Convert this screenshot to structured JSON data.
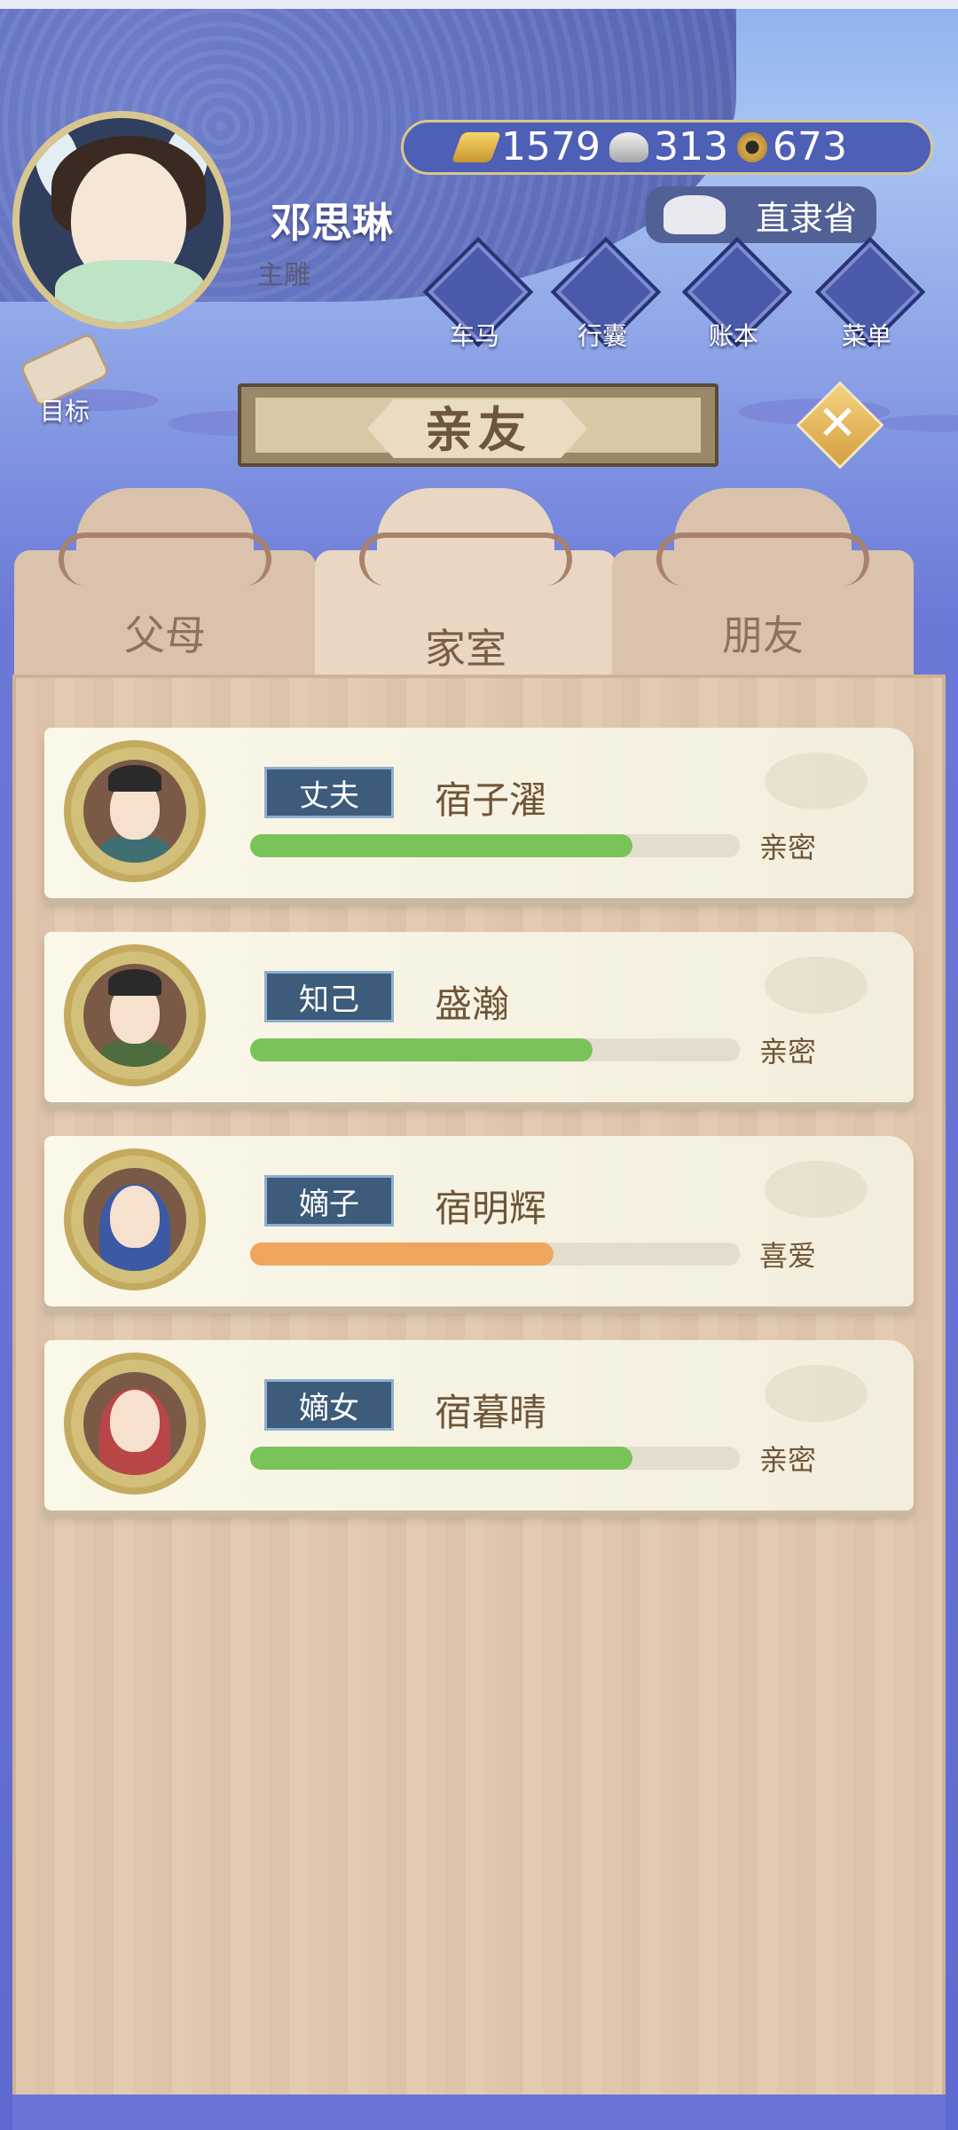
{
  "profile": {
    "name": "邓思琳",
    "rank": "主雕",
    "region": "直隶省"
  },
  "currency": {
    "gold": "1579",
    "silver": "313",
    "copper": "673"
  },
  "toolbar": {
    "items": [
      {
        "label": "车马",
        "icon": "carriage-icon"
      },
      {
        "label": "行囊",
        "icon": "bag-icon"
      },
      {
        "label": "账本",
        "icon": "ledger-icon"
      },
      {
        "label": "菜单",
        "icon": "menu-dots-icon"
      }
    ],
    "goal_label": "目标"
  },
  "header": {
    "title": "亲友"
  },
  "tabs": [
    {
      "label": "父母",
      "active": false
    },
    {
      "label": "家室",
      "active": true
    },
    {
      "label": "朋友",
      "active": false
    }
  ],
  "colors": {
    "bar_green": "#7ac35a",
    "bar_orange": "#f0a55e",
    "role_blue": "#3d5b7a",
    "accent_gold": "#d9c78c"
  },
  "relations": [
    {
      "role": "丈夫",
      "name": "宿子濯",
      "status": "亲密",
      "affinity": 0.78,
      "bar_color": "green"
    },
    {
      "role": "知己",
      "name": "盛瀚",
      "status": "亲密",
      "affinity": 0.7,
      "bar_color": "green"
    },
    {
      "role": "嫡子",
      "name": "宿明辉",
      "status": "喜爱",
      "affinity": 0.62,
      "bar_color": "orange"
    },
    {
      "role": "嫡女",
      "name": "宿暮晴",
      "status": "亲密",
      "affinity": 0.78,
      "bar_color": "green"
    }
  ]
}
